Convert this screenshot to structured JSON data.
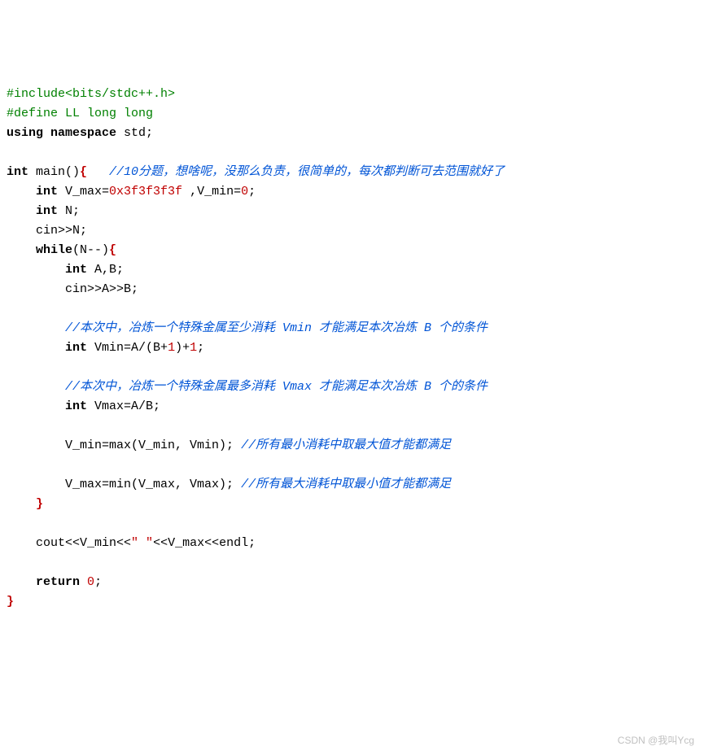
{
  "code": {
    "l01_include": "#include<bits/stdc++.h>",
    "l02_define": "#define LL long long",
    "l03_using": "using",
    "l03_namespace": "namespace",
    "l03_std": " std;",
    "l05_int": "int",
    "l05_main": " main()",
    "l05_brace": "{",
    "l05_cm": "   //10分题，想啥呢，没那么负责，很简单的，每次都判断可去范围就好了",
    "l06_int": "int",
    "l06_a": " V_max=",
    "l06_v1": "0x3f3f3f3f",
    "l06_b": " ,V_min=",
    "l06_v2": "0",
    "l06_c": ";",
    "l07_int": "int",
    "l07_rest": " N;",
    "l08": "cin>>N;",
    "l09_while": "while",
    "l09_a": "(N--)",
    "l09_brace": "{",
    "l10_int": "int",
    "l10_rest": " A,B;",
    "l11": "cin>>A>>B;",
    "l13_cm": "//本次中，冶炼一个特殊金属至少消耗 Vmin 才能满足本次冶炼 B 个的条件",
    "l14_int": "int",
    "l14_a": " Vmin=A/(B+",
    "l14_v1": "1",
    "l14_b": ")+",
    "l14_v2": "1",
    "l14_c": ";",
    "l16_cm": "//本次中，冶炼一个特殊金属最多消耗 Vmax 才能满足本次冶炼 B 个的条件",
    "l17_int": "int",
    "l17_rest": " Vmax=A/B;",
    "l19_a": "V_min=max(V_min, Vmin); ",
    "l19_cm": "//所有最小消耗中取最大值才能都满足",
    "l21_a": "V_max=min(V_max, Vmax); ",
    "l21_cm": "//所有最大消耗中取最小值才能都满足",
    "l22_brace": "}",
    "l24_a": "cout<<V_min<<",
    "l24_str": "\" \"",
    "l24_b": "<<V_max<<endl;",
    "l26_ret": "return",
    "l26_v": "0",
    "l26_c": ";",
    "l27_brace": "}"
  },
  "watermark": "CSDN @我叫Ycg"
}
